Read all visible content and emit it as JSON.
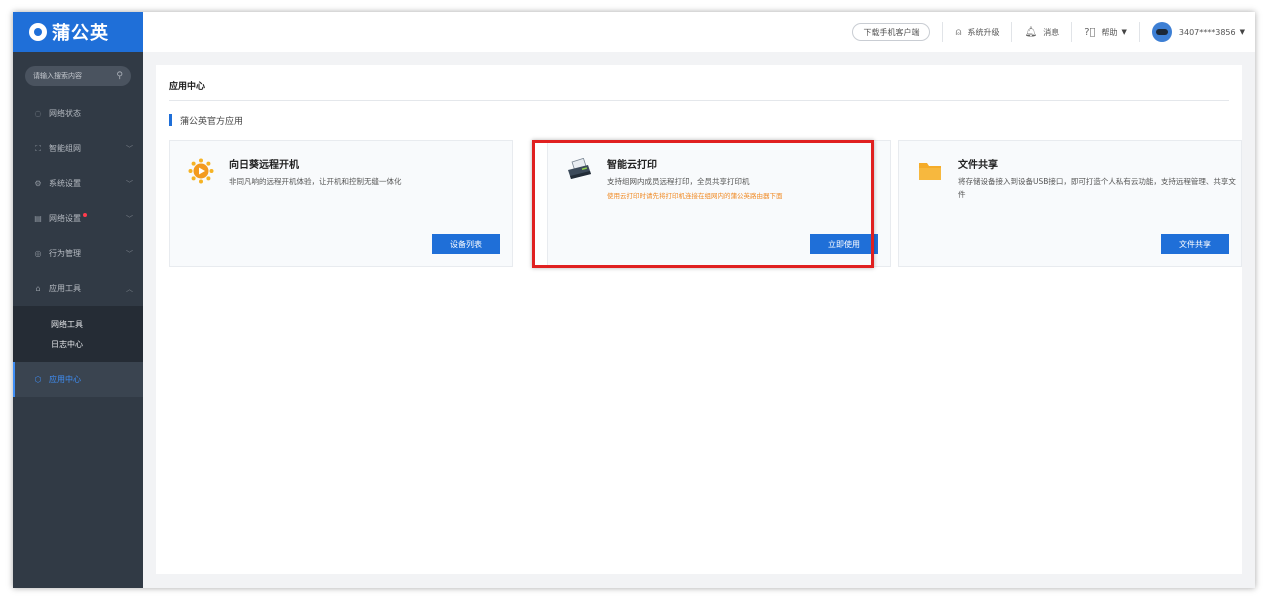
{
  "brand": {
    "name": "蒲公英"
  },
  "sidebar": {
    "search_placeholder": "请输入搜索内容",
    "items": [
      {
        "label": "网络状态",
        "icon": "network-status-icon"
      },
      {
        "label": "智能组网",
        "icon": "smart-network-icon"
      },
      {
        "label": "系统设置",
        "icon": "gear-icon"
      },
      {
        "label": "网络设置",
        "icon": "network-settings-icon"
      },
      {
        "label": "行为管理",
        "icon": "behavior-icon"
      },
      {
        "label": "应用工具",
        "icon": "toolbox-icon"
      }
    ],
    "sub_items": [
      {
        "label": "网络工具"
      },
      {
        "label": "日志中心"
      }
    ],
    "active_item": {
      "label": "应用中心",
      "icon": "app-center-icon"
    }
  },
  "topbar": {
    "download_label": "下载手机客户端",
    "upgrade_label": "系统升级",
    "messages_label": "消息",
    "help_label": "帮助",
    "user_label": "3407****3856"
  },
  "main": {
    "title": "应用中心",
    "section_title": "蒲公英官方应用",
    "cards": [
      {
        "title": "向日葵远程开机",
        "desc": "非同凡响的远程开机体验，让开机和控制无缝一体化",
        "note": "",
        "button": "设备列表"
      },
      {
        "title": "智能云打印",
        "desc": "支持组网内成员远程打印，全员共享打印机",
        "note": "使用云打印时请先将打印机连接在组网内的蒲公英路由器下面",
        "button": "立即使用"
      },
      {
        "title": "文件共享",
        "desc": "将存储设备接入到设备USB接口，即可打造个人私有云功能，支持远程管理、共享文件",
        "note": "",
        "button": "文件共享"
      }
    ]
  },
  "colors": {
    "accent": "#1f6fd8",
    "sidebar_bg": "#313a45",
    "note_orange": "#f08a24",
    "highlight_red": "#e02020"
  }
}
